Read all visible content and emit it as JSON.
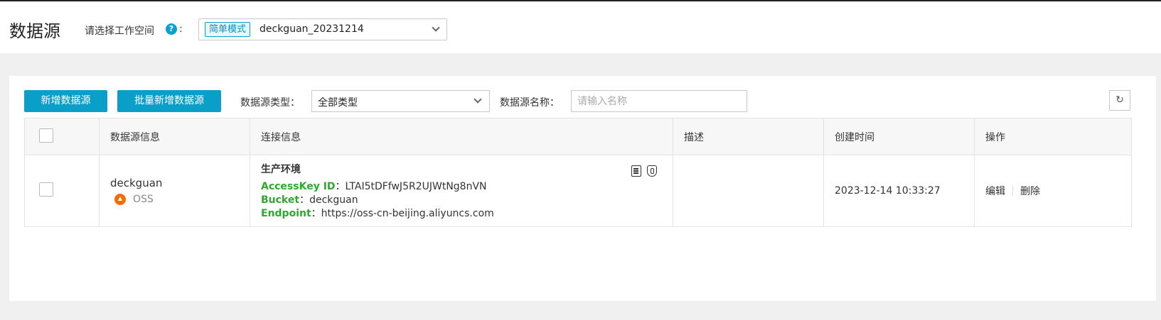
{
  "header": {
    "title": "数据源",
    "workspace_label": "请选择工作空间",
    "colon": ":",
    "help_icon": "?",
    "workspace_mode": "简单模式",
    "workspace_value": "deckguan_20231214"
  },
  "toolbar": {
    "add_label": "新增数据源",
    "batch_add_label": "批量新增数据源",
    "type_label": "数据源类型：",
    "type_value": "全部类型",
    "name_label": "数据源名称：",
    "name_placeholder": "请输入名称",
    "refresh_icon": "↻"
  },
  "table": {
    "columns": [
      "数据源信息",
      "连接信息",
      "描述",
      "创建时间",
      "操作"
    ],
    "rows": [
      {
        "name": "deckguan",
        "type": "OSS",
        "env": "生产环境",
        "access_key_label": "AccessKey ID",
        "access_key": "LTAI5tDFfwJ5R2UJWtNg8nVN",
        "bucket_label": "Bucket",
        "bucket": "deckguan",
        "endpoint_label": "Endpoint",
        "endpoint": "https://oss-cn-beijing.aliyuncs.com",
        "sep": "：",
        "description": "",
        "created": "2023-12-14 10:33:27",
        "edit_label": "编辑",
        "delete_label": "删除"
      }
    ]
  },
  "colors": {
    "accent": "#0a9fc8",
    "key_green": "#2ea92e",
    "oss_orange": "#ff6a00"
  }
}
